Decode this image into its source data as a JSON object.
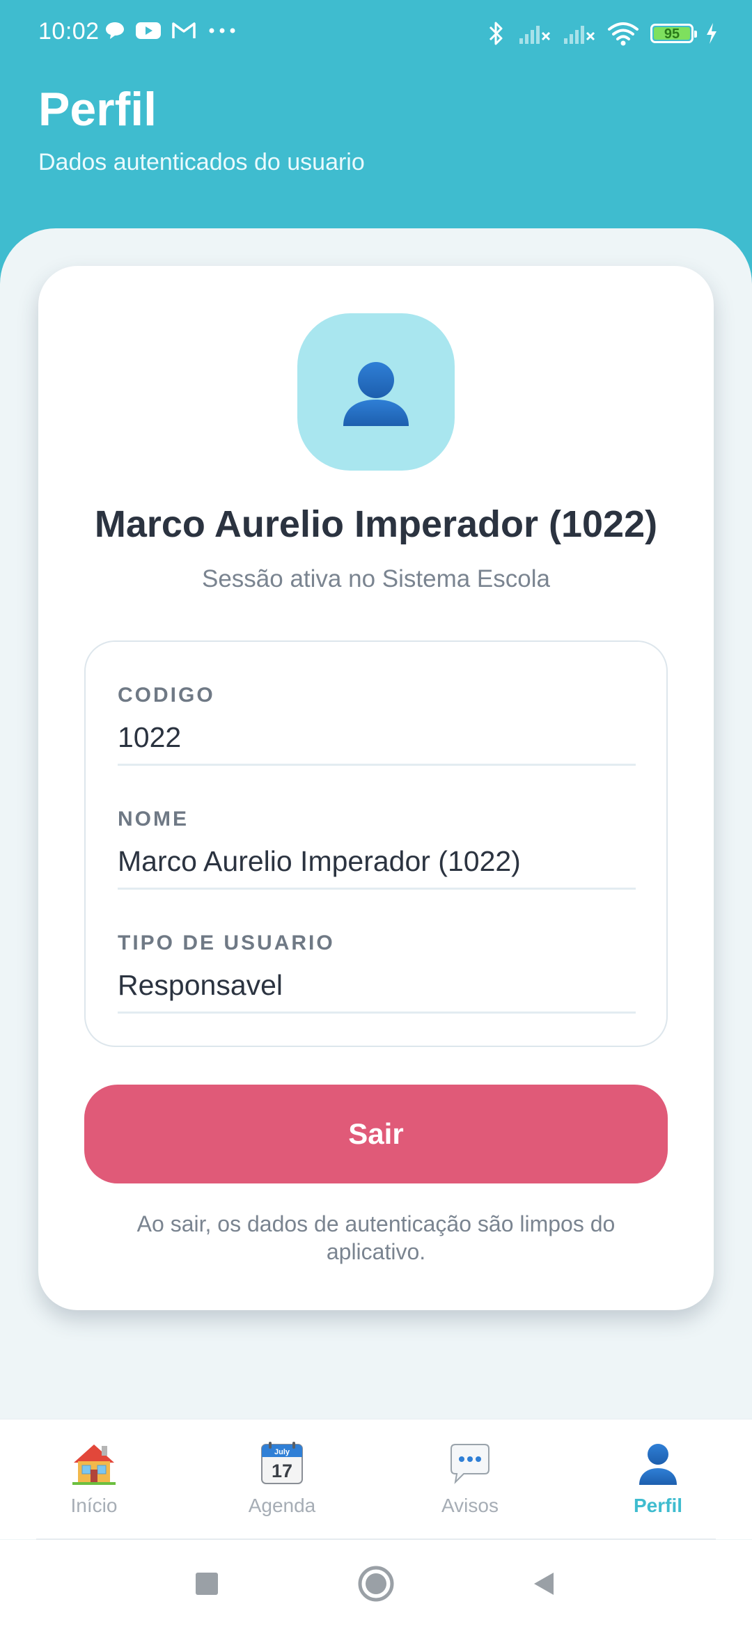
{
  "status_bar": {
    "time": "10:02",
    "notification_icons": [
      "chat-icon",
      "youtube-icon",
      "gmail-icon",
      "more-dots-icon"
    ],
    "system_icons": [
      "bluetooth-icon",
      "signal-off-icon",
      "signal-off-icon",
      "wifi-icon",
      "battery-icon",
      "charging-icon"
    ],
    "battery_level": "95"
  },
  "header": {
    "title": "Perfil",
    "subtitle": "Dados autenticados do usuario"
  },
  "profile": {
    "avatar_icon": "user-silhouette-icon",
    "name": "Marco Aurelio Imperador (1022)",
    "session_text": "Sessão ativa no Sistema Escola",
    "fields": [
      {
        "label": "CODIGO",
        "value": "1022"
      },
      {
        "label": "NOME",
        "value": "Marco Aurelio Imperador (1022)"
      },
      {
        "label": "TIPO DE USUARIO",
        "value": "Responsavel"
      }
    ],
    "logout_label": "Sair",
    "logout_note": "Ao sair, os dados de autenticação são limpos do aplicativo."
  },
  "bottom_nav": {
    "items": [
      {
        "label": "Início",
        "icon": "house-icon",
        "active": false
      },
      {
        "label": "Agenda",
        "icon": "calendar-icon",
        "calendar_month": "July",
        "calendar_day": "17",
        "active": false
      },
      {
        "label": "Avisos",
        "icon": "speech-bubble-icon",
        "active": false
      },
      {
        "label": "Perfil",
        "icon": "user-icon",
        "active": true
      }
    ]
  },
  "colors": {
    "header": "#3fbccf",
    "logout_button": "#e05a78",
    "active_tab": "#3fbccf",
    "avatar_bg": "#a9e6ef"
  }
}
